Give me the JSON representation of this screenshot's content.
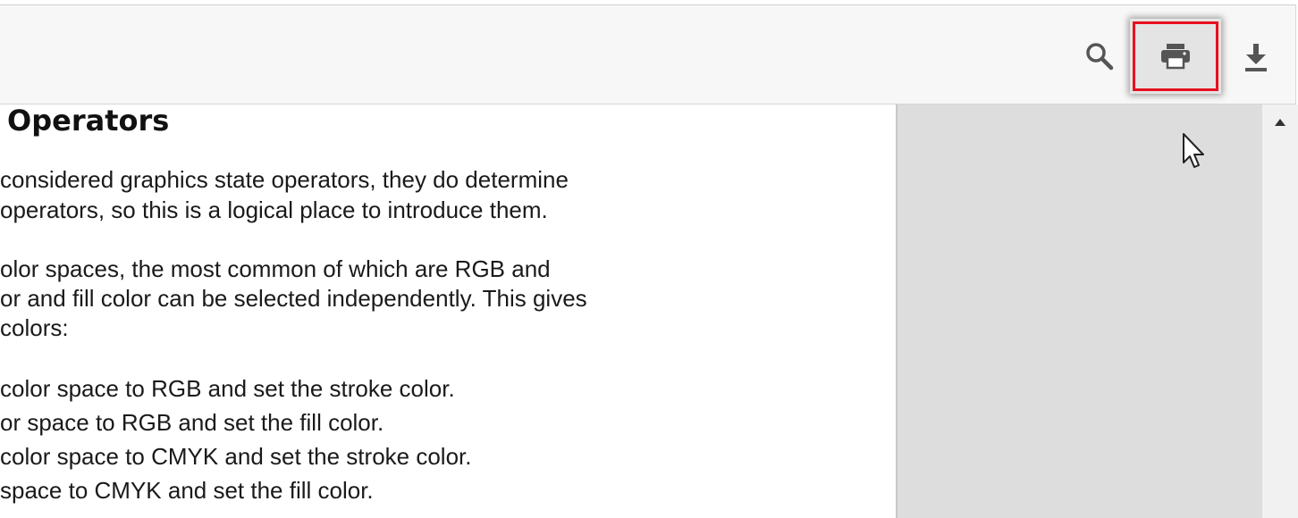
{
  "toolbar": {
    "buttons": [
      {
        "name": "search",
        "icon": "search-icon"
      },
      {
        "name": "print",
        "icon": "print-icon",
        "highlighted": true,
        "highlight_color": "#e8101e"
      },
      {
        "name": "download",
        "icon": "download-icon"
      }
    ]
  },
  "document": {
    "heading": "Operators",
    "lines": [
      "considered graphics state operators, they do determine",
      "operators, so this is a logical place to introduce them.",
      "olor spaces, the most common of which are RGB and",
      "or and fill color can be selected independently. This gives",
      "colors:",
      "color space to RGB and set the stroke color.",
      "or space to RGB and set the fill color.",
      "color space to CMYK and set the stroke color.",
      "space to CMYK and set the fill color."
    ]
  },
  "scrollbar": {
    "up_icon": "triangle-up-icon"
  },
  "cursor": {
    "icon": "mouse-pointer-icon"
  },
  "colors": {
    "toolbar_bg": "#f7f7f7",
    "panel_bg": "#dddddd",
    "highlight": "#e8101e",
    "icon": "#555555"
  }
}
